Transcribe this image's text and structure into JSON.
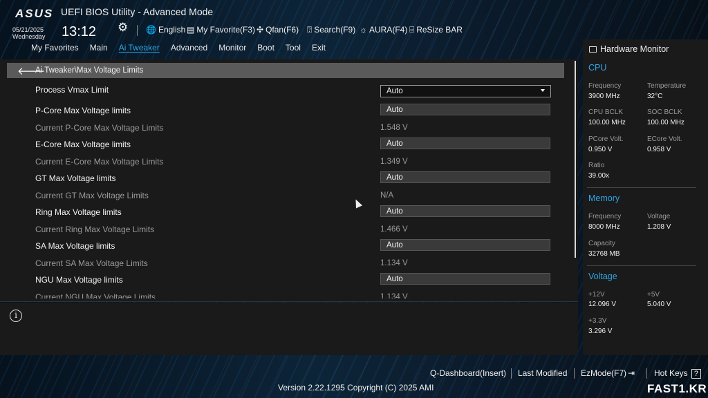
{
  "header": {
    "logo": "ASUS",
    "title": "UEFI BIOS Utility - Advanced Mode",
    "date": "05/21/2025",
    "weekday": "Wednesday",
    "time": "13:12",
    "hotkeys": [
      {
        "icon": "globe-icon",
        "label": "English"
      },
      {
        "icon": "favorite-icon",
        "label": "My Favorite(F3)"
      },
      {
        "icon": "fan-icon",
        "label": "Qfan(F6)"
      },
      {
        "icon": "search-icon",
        "label": "Search(F9)"
      },
      {
        "icon": "aura-icon",
        "label": "AURA(F4)"
      },
      {
        "icon": "resize-bar-icon",
        "label": "ReSize BAR"
      }
    ]
  },
  "nav": {
    "tabs": [
      "My Favorites",
      "Main",
      "Ai Tweaker",
      "Advanced",
      "Monitor",
      "Boot",
      "Tool",
      "Exit"
    ],
    "active": "Ai Tweaker"
  },
  "breadcrumb": "Ai Tweaker\\Max Voltage Limits",
  "rows": [
    {
      "label": "Process Vmax Limit",
      "value": "Auto",
      "type": "select"
    },
    {
      "label": "P-Core Max Voltage limits",
      "value": "Auto",
      "type": "input"
    },
    {
      "label": "Current P-Core Max Voltage Limits",
      "value": "1.548 V",
      "type": "readonly"
    },
    {
      "label": "E-Core Max Voltage limits",
      "value": "Auto",
      "type": "input"
    },
    {
      "label": "Current E-Core Max Voltage Limits",
      "value": "1.349 V",
      "type": "readonly"
    },
    {
      "label": "GT Max Voltage limits",
      "value": "Auto",
      "type": "input"
    },
    {
      "label": "Current GT Max Voltage Limits",
      "value": "N/A",
      "type": "readonly"
    },
    {
      "label": "Ring Max Voltage limits",
      "value": "Auto",
      "type": "input"
    },
    {
      "label": "Current Ring Max Voltage Limits",
      "value": "1.466 V",
      "type": "readonly"
    },
    {
      "label": "SA Max Voltage limits",
      "value": "Auto",
      "type": "input"
    },
    {
      "label": "Current SA Max Voltage Limits",
      "value": "1.134 V",
      "type": "readonly"
    },
    {
      "label": "NGU Max Voltage limits",
      "value": "Auto",
      "type": "input"
    },
    {
      "label": "Current NGU Max Voltage Limits",
      "value": "1.134 V",
      "type": "readonly"
    }
  ],
  "hardware_monitor": {
    "title": "Hardware Monitor",
    "cpu": {
      "heading": "CPU",
      "frequency_label": "Frequency",
      "frequency": "3900 MHz",
      "temperature_label": "Temperature",
      "temperature": "32°C",
      "cpu_bclk_label": "CPU BCLK",
      "cpu_bclk": "100.00 MHz",
      "soc_bclk_label": "SOC BCLK",
      "soc_bclk": "100.00 MHz",
      "pcore_volt_label": "PCore Volt.",
      "pcore_volt": "0.950 V",
      "ecore_volt_label": "ECore Volt.",
      "ecore_volt": "0.958 V",
      "ratio_label": "Ratio",
      "ratio": "39.00x"
    },
    "memory": {
      "heading": "Memory",
      "frequency_label": "Frequency",
      "frequency": "8000 MHz",
      "voltage_label": "Voltage",
      "voltage": "1.208 V",
      "capacity_label": "Capacity",
      "capacity": "32768 MB"
    },
    "voltage": {
      "heading": "Voltage",
      "v12_label": "+12V",
      "v12": "12.096 V",
      "v5_label": "+5V",
      "v5": "5.040 V",
      "v33_label": "+3.3V",
      "v33": "3.296 V"
    }
  },
  "footer": {
    "q_dashboard": "Q-Dashboard(Insert)",
    "last_modified": "Last Modified",
    "ezmode": "EzMode(F7)",
    "hot_keys": "Hot Keys",
    "version": "Version 2.22.1295 Copyright (C) 2025 AMI",
    "watermark": "FAST1.KR"
  },
  "colors": {
    "accent": "#2ea7e8",
    "panel": "#1a1a1a",
    "breadcrumb_bar": "#5a5a5a"
  }
}
